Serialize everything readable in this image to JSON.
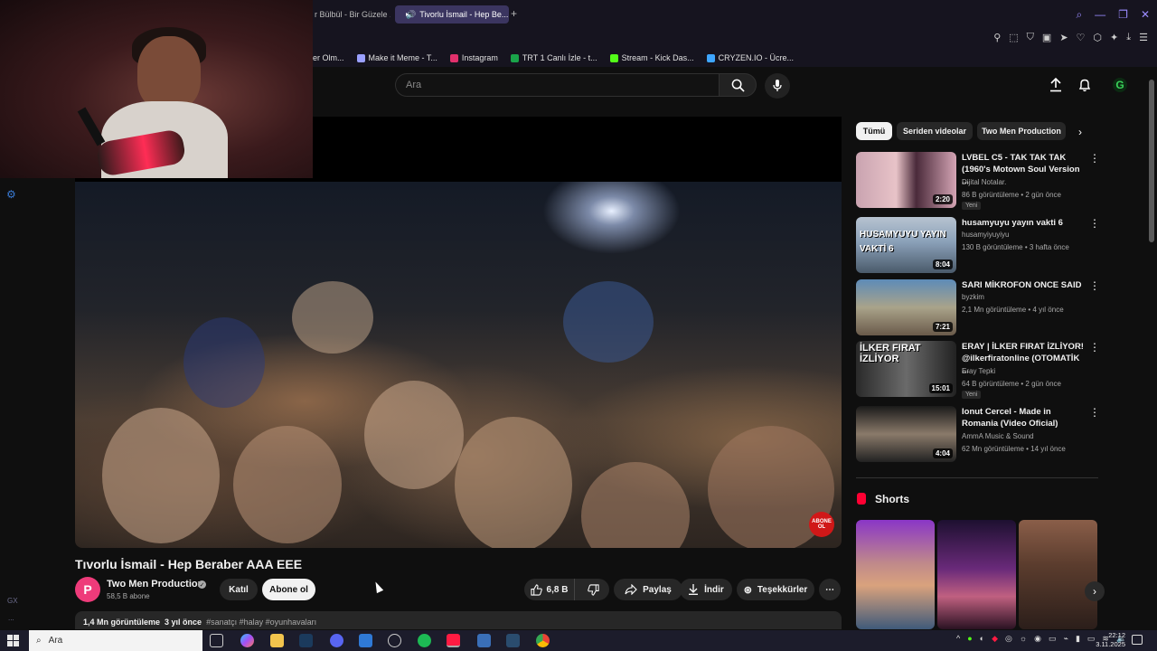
{
  "browser": {
    "tabs": [
      {
        "label": "r Bülbül - Bir Güzele ..."
      },
      {
        "label": "Tivorlu İsmail - Hep Be..."
      }
    ],
    "bookmarks": [
      {
        "label": "er Olm...",
        "color": "#888888"
      },
      {
        "label": "Make it Meme - T...",
        "color": "#9aa0ff"
      },
      {
        "label": "Instagram",
        "color": "#e1306c"
      },
      {
        "label": "TRT 1 Canlı İzle - t...",
        "color": "#1aa34a"
      },
      {
        "label": "Stream - Kick Das...",
        "color": "#53fc18"
      },
      {
        "label": "CRYZEN.IO - Ücre...",
        "color": "#3ea6ff"
      }
    ]
  },
  "header": {
    "search_placeholder": "Ara"
  },
  "video": {
    "title": "Tıvorlu İsmail - Hep Beraber AAA EEE",
    "channel": "Two Men Production",
    "subscribers": "58,5 B abone",
    "join_label": "Katıl",
    "subscribe_label": "Abone ol",
    "likes": "6,8 B",
    "share_label": "Paylaş",
    "download_label": "İndir",
    "thanks_label": "Teşekkürler",
    "badge_text": "ABONE OL",
    "views": "1,4 Mn görüntüleme",
    "age": "3 yıl önce",
    "tags": "#sanatçı #halay #oyunhavaları"
  },
  "chips": [
    "Tümü",
    "Seriden videolar",
    "Two Men Production"
  ],
  "recommendations": [
    {
      "title": "LVBEL C5 - TAK TAK TAK (1960's Motown Soul Version ...",
      "channel": "Dijital Notalar.",
      "meta": "86 B görüntüleme • 2 gün önce",
      "badge": "Yeni",
      "duration": "2:20",
      "thumb_text": ""
    },
    {
      "title": "husamyuyu yayın vakti 6",
      "channel": "husamyiyuyiyu",
      "meta": "130 B görüntüleme • 3 hafta önce",
      "badge": "",
      "duration": "8:04",
      "thumb_text": "HUSAMYUYU YAYIN VAKTİ 6"
    },
    {
      "title": "SARI MİKROFON ONCE SAID",
      "channel": "byzkim",
      "meta": "2,1 Mn görüntüleme • 4 yıl önce",
      "badge": "",
      "duration": "7:21",
      "thumb_text": ""
    },
    {
      "title": "ERAY | İLKER FIRAT İZLİYOR! @ilkerfiratonline (OTOMATİK ...",
      "channel": "Eray Tepki",
      "meta": "64 B görüntüleme • 2 gün önce",
      "badge": "Yeni",
      "duration": "15:01",
      "thumb_text": "İLKER FIRAT İZLİYOR"
    },
    {
      "title": "Ionut Cercel - Made in Romania (Video Oficial)",
      "channel": "AmmA Music & Sound",
      "meta": "62 Mn görüntüleme • 14 yıl önce",
      "badge": "",
      "duration": "4:04",
      "thumb_text": ""
    }
  ],
  "shorts": {
    "title": "Shorts"
  },
  "sidebar": {
    "gx_label": "GX",
    "dots_label": "..."
  },
  "taskbar": {
    "search_placeholder": "Ara",
    "time": "22:12",
    "date": "3.11.2025"
  },
  "colors": {
    "accent": "#ff0033",
    "subscribe_bg": "#f1f1f1",
    "tab_active": "#3b3560"
  }
}
